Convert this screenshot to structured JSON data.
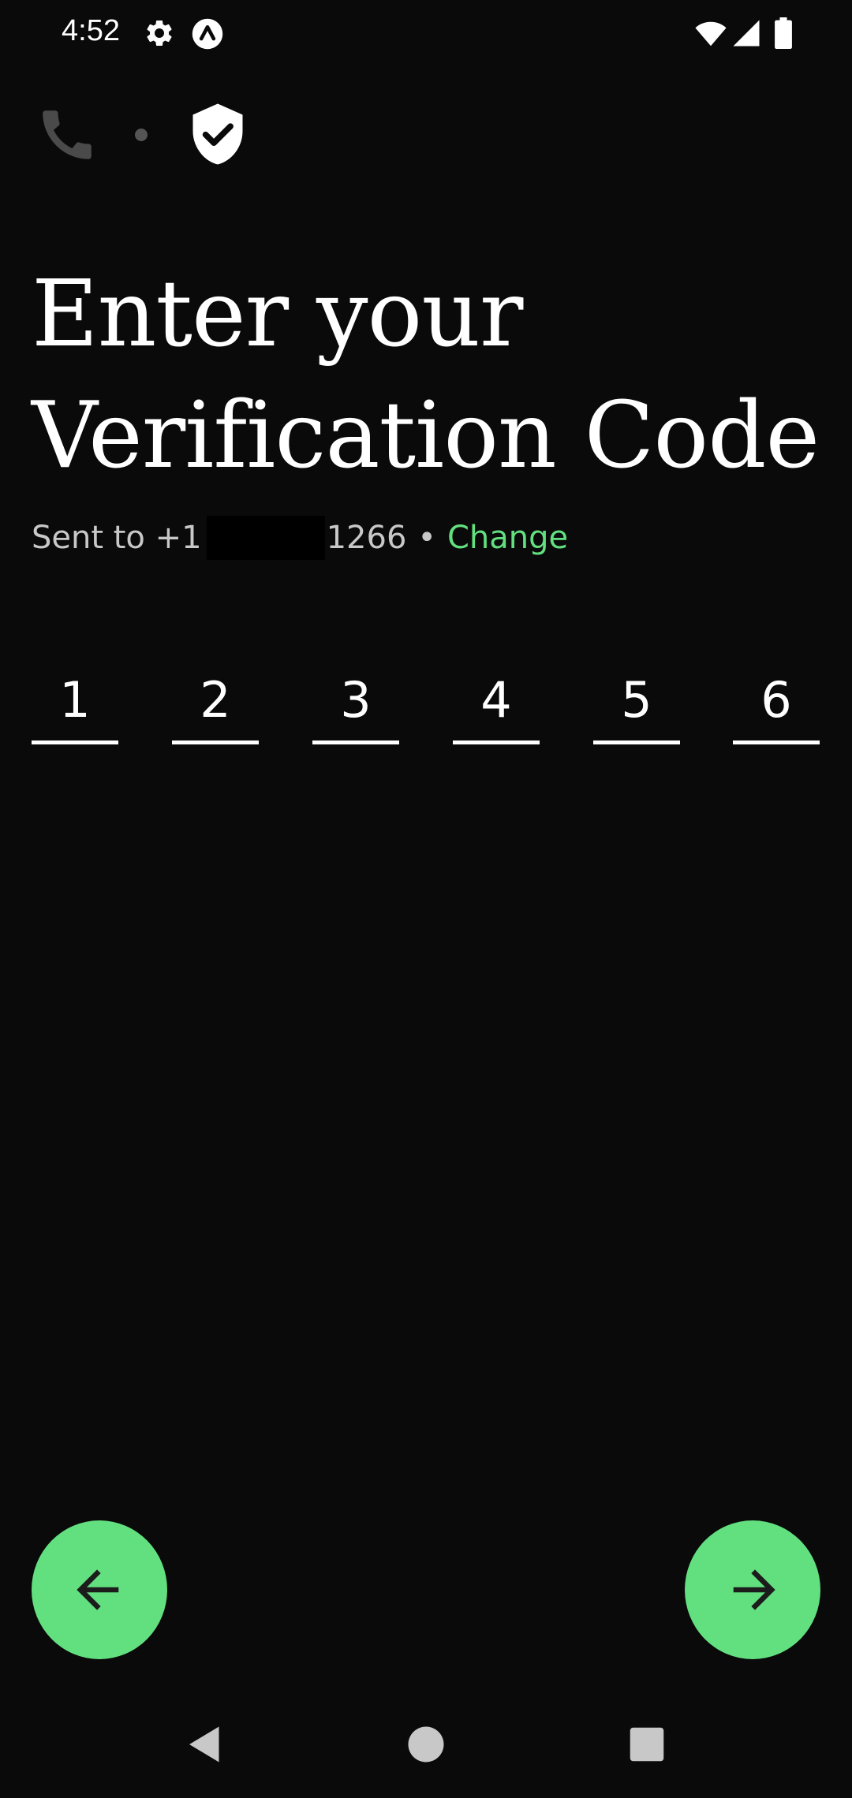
{
  "status_bar": {
    "time": "4:52",
    "icons": [
      "gear-icon",
      "app-status-icon",
      "wifi-icon",
      "signal-icon",
      "battery-icon"
    ]
  },
  "progress": {
    "steps": [
      "phone-icon",
      "shield-icon"
    ],
    "current_step": 2,
    "total_steps": 2
  },
  "title": "Enter your Verification Code",
  "sent_to": {
    "prefix": "Sent to +1",
    "number_suffix": "1266",
    "separator": "•",
    "change_label": "Change"
  },
  "code": {
    "digits": [
      "1",
      "2",
      "3",
      "4",
      "5",
      "6"
    ]
  },
  "nav": {
    "back_icon": "arrow-left-icon",
    "next_icon": "arrow-right-icon"
  },
  "colors": {
    "background": "#0a0a0a",
    "accent": "#62e07f",
    "text": "#ffffff",
    "muted_text": "#c8c8c8"
  }
}
